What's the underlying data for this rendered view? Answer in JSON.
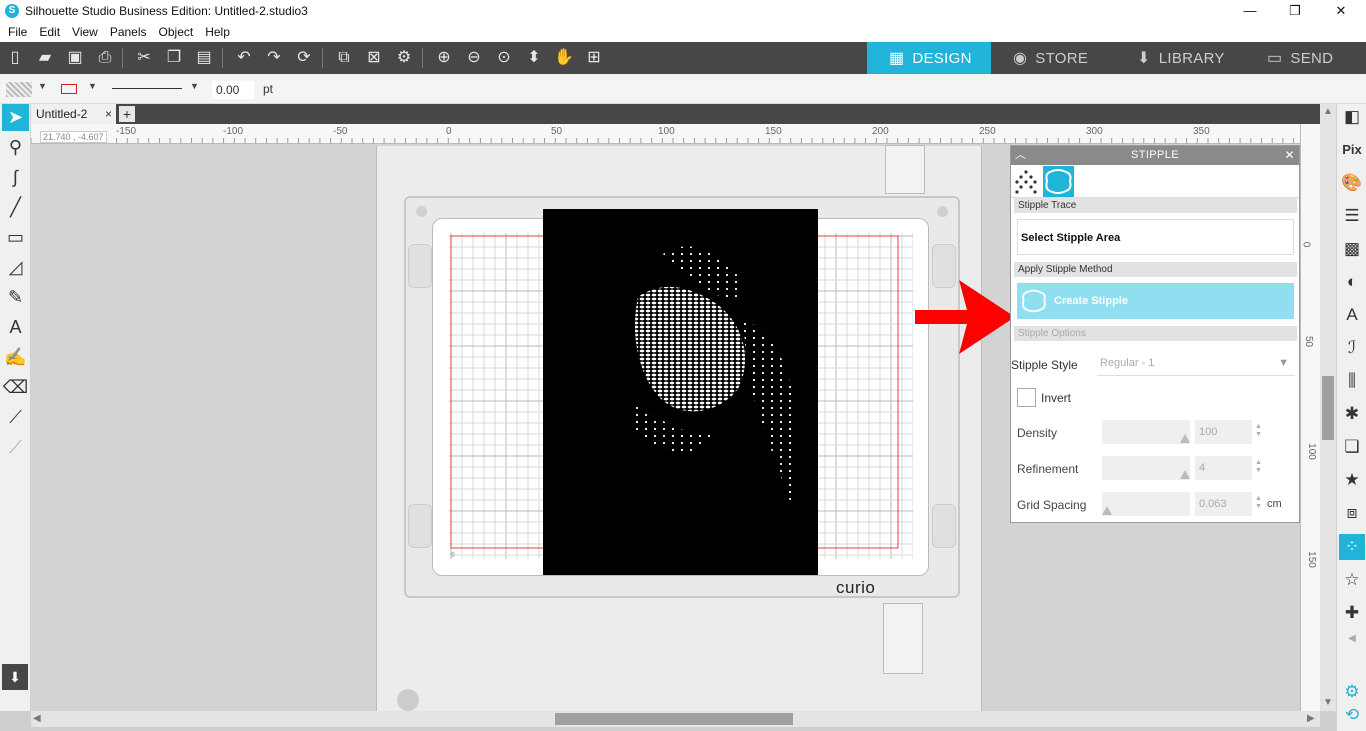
{
  "window": {
    "title": "Silhouette Studio Business Edition: Untitled-2.studio3",
    "minimize": "—",
    "maximize": "❐",
    "close": "✕"
  },
  "menu": [
    "File",
    "Edit",
    "View",
    "Panels",
    "Object",
    "Help"
  ],
  "nav_tabs": [
    {
      "label": "DESIGN",
      "icon": "grid-icon",
      "active": true
    },
    {
      "label": "STORE",
      "icon": "store-icon",
      "active": false
    },
    {
      "label": "LIBRARY",
      "icon": "library-icon",
      "active": false
    },
    {
      "label": "SEND",
      "icon": "send-icon",
      "active": false
    }
  ],
  "props": {
    "line_width_value": "0.00",
    "line_width_unit": "pt"
  },
  "document": {
    "tab_label": "Untitled-2",
    "tab_close": "×",
    "add_tab": "+"
  },
  "ruler": {
    "coords": "21.740 , -4.607",
    "h_ticks": [
      "-150",
      "-100",
      "-50",
      "0",
      "50",
      "100",
      "150",
      "200",
      "250",
      "300",
      "350"
    ],
    "v_ticks": [
      "0",
      "50",
      "100",
      "150"
    ]
  },
  "mat": {
    "brand": "curio",
    "corner_number": "6"
  },
  "stipple_panel": {
    "title": "STIPPLE",
    "section_trace": "Stipple Trace",
    "select_area": "Select Stipple Area",
    "section_apply": "Apply Stipple Method",
    "create_button": "Create Stipple",
    "section_options": "Stipple Options",
    "style_label": "Stipple Style",
    "style_value": "Regular - 1",
    "invert_label": "Invert",
    "density_label": "Density",
    "density_value": "100",
    "density_level": 1.0,
    "refinement_label": "Refinement",
    "refinement_value": "4",
    "refinement_level": 1.0,
    "grid_label": "Grid Spacing",
    "grid_value": "0.063",
    "grid_unit": "cm",
    "grid_level": 0.0
  },
  "colors": {
    "accent": "#20b4d9",
    "toolbar": "#474747",
    "arrow": "#ff0000",
    "mat_line": "#e04040"
  }
}
